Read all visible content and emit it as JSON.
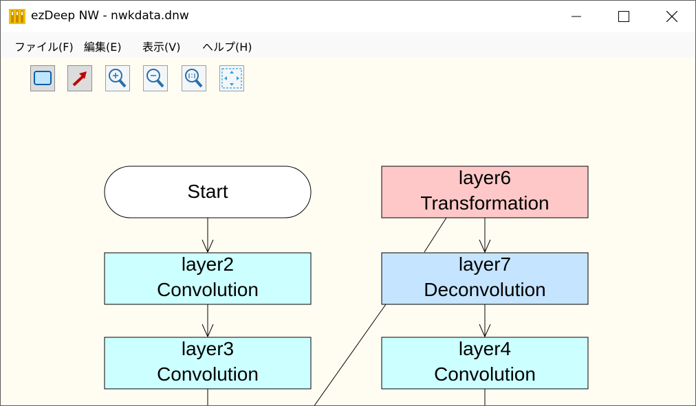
{
  "window": {
    "title": "ezDeep NW - nwkdata.dnw",
    "app_icon": "app-icon"
  },
  "menu": {
    "items": [
      "ファイル(F)",
      "編集(E)",
      "表示(V)",
      "ヘルプ(H)"
    ]
  },
  "toolbar": {
    "buttons": [
      "node-tool-icon",
      "arrow-tool-icon",
      "zoom-in-icon",
      "zoom-out-icon",
      "zoom-reset-icon",
      "fit-to-screen-icon"
    ]
  },
  "diagram": {
    "start": {
      "label": "Start"
    },
    "layer2": {
      "name": "layer2",
      "type": "Convolution",
      "fill": "#ccffff"
    },
    "layer3": {
      "name": "layer3",
      "type": "Convolution",
      "fill": "#ccffff"
    },
    "layer6": {
      "name": "layer6",
      "type": "Transformation",
      "fill": "#ffc8c8"
    },
    "layer7": {
      "name": "layer7",
      "type": "Deconvolution",
      "fill": "#c5e4ff"
    },
    "layer4": {
      "name": "layer4",
      "type": "Convolution",
      "fill": "#ccffff"
    }
  }
}
